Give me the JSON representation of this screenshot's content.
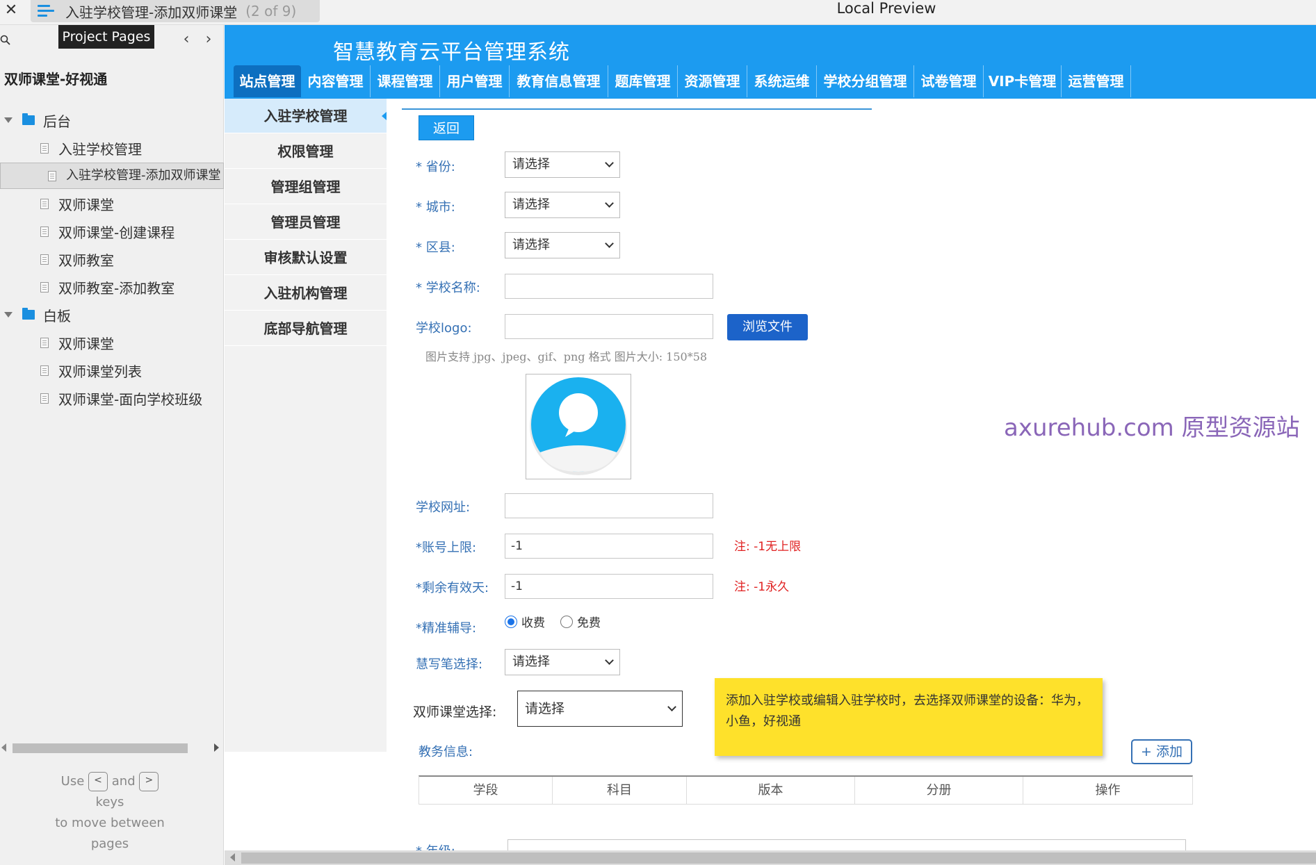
{
  "topbar": {
    "tab_title": "入驻学校管理-添加双师课堂",
    "tab_count": "(2 of 9)",
    "preview_label": "Local Preview"
  },
  "sidebar": {
    "tooltip": "Project Pages",
    "project_name": "双师课堂-好视通",
    "tree": [
      {
        "type": "folder",
        "label": "后台"
      },
      {
        "type": "page",
        "label": "入驻学校管理"
      },
      {
        "type": "page",
        "label": "入驻学校管理-添加双师课堂",
        "selected": true
      },
      {
        "type": "page",
        "label": "双师课堂"
      },
      {
        "type": "page",
        "label": "双师课堂-创建课程"
      },
      {
        "type": "page",
        "label": "双师教室"
      },
      {
        "type": "page",
        "label": "双师教室-添加教室"
      },
      {
        "type": "folder",
        "label": "白板"
      },
      {
        "type": "page",
        "label": "双师课堂"
      },
      {
        "type": "page",
        "label": "双师课堂列表"
      },
      {
        "type": "page",
        "label": "双师课堂-面向学校班级"
      }
    ],
    "help": {
      "use": "Use",
      "and": "and",
      "keys": "keys",
      "move": "to move between",
      "pages": "pages",
      "key_prev": "<",
      "key_next": ">"
    }
  },
  "app": {
    "title": "智慧教育云平台管理系统",
    "nav_tabs": [
      "站点管理",
      "内容管理",
      "课程管理",
      "用户管理",
      "教育信息管理",
      "题库管理",
      "资源管理",
      "系统运维",
      "学校分组管理",
      "试卷管理",
      "VIP卡管理",
      "运营管理"
    ],
    "side_menu": [
      "入驻学校管理",
      "权限管理",
      "管理组管理",
      "管理员管理",
      "审核默认设置",
      "入驻机构管理",
      "底部导航管理"
    ]
  },
  "form": {
    "back_label": "返回",
    "province": {
      "label": "* 省份:",
      "value": "请选择"
    },
    "city": {
      "label": "* 城市:",
      "value": "请选择"
    },
    "district": {
      "label": "* 区县:",
      "value": "请选择"
    },
    "school_name": {
      "label": "* 学校名称:",
      "value": ""
    },
    "school_logo": {
      "label": "学校logo:",
      "value": "",
      "browse_label": "浏览文件"
    },
    "logo_hint": "图片支持 jpg、jpeg、gif、png 格式 图片大小: 150*58",
    "school_url": {
      "label": "学校网址:",
      "value": ""
    },
    "account_limit": {
      "label": "*账号上限:",
      "value": "-1",
      "note": "注: -1无上限"
    },
    "remaining_days": {
      "label": "*剩余有效天:",
      "value": "-1",
      "note": "注: -1永久"
    },
    "tutoring": {
      "label": "*精准辅导:",
      "option_paid": "收费",
      "option_free": "免费",
      "selected": "收费"
    },
    "pen": {
      "label": "慧写笔选择:",
      "value": "请选择"
    },
    "dual_classroom": {
      "label": "双师课堂选择:",
      "value": "请选择"
    },
    "sticky_note": "添加入驻学校或编辑入驻学校时，去选择双师课堂的设备：华为，小鱼，好视通",
    "academic": {
      "label": "教务信息:",
      "add_label": "+ 添加",
      "columns": [
        "学段",
        "科目",
        "版本",
        "分册",
        "操作"
      ]
    },
    "grade_label": "* 年级:"
  },
  "watermark": "axurehub.com 原型资源站",
  "colors": {
    "header_blue": "#1c9bf0",
    "active_tab": "#0d6fc0",
    "label_blue": "#3470b4",
    "note_red": "#e02020",
    "sticky_yellow": "#fee12b"
  }
}
